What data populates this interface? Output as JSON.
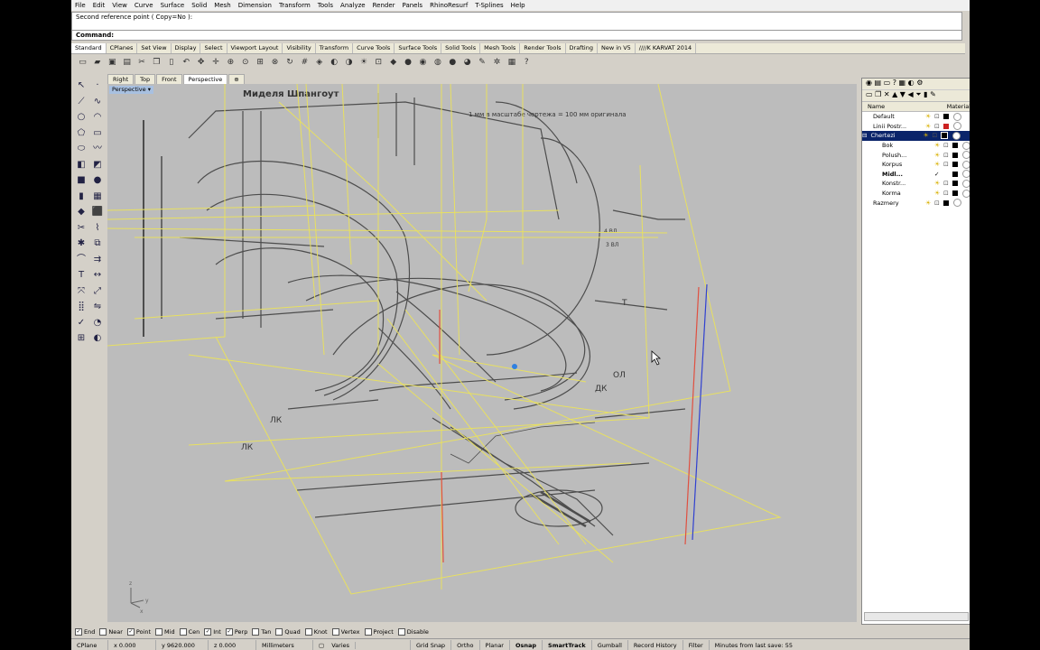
{
  "menu": [
    "File",
    "Edit",
    "View",
    "Curve",
    "Surface",
    "Solid",
    "Mesh",
    "Dimension",
    "Transform",
    "Tools",
    "Analyze",
    "Render",
    "Panels",
    "RhinoResurf",
    "T-Splines",
    "Help"
  ],
  "command": {
    "history": "Second reference point ( Copy=No ):",
    "prompt": "Command:"
  },
  "toolbar_tabs": [
    "Standard",
    "CPlanes",
    "Set View",
    "Display",
    "Select",
    "Viewport Layout",
    "Visibility",
    "Transform",
    "Curve Tools",
    "Surface Tools",
    "Solid Tools",
    "Mesh Tools",
    "Render Tools",
    "Drafting",
    "New in V5",
    "////K KARVAT 2014"
  ],
  "viewport_tabs": [
    "Right",
    "Top",
    "Front",
    "Perspective",
    "⊕"
  ],
  "viewport": {
    "title": "Perspective",
    "drawing_texts": [
      "Миделя Шпангоут",
      "1 мм в масштабе чертежа = 100 мм оригинала",
      "ЛК",
      "ОЛ",
      "ДК",
      "Т",
      "ЛК",
      "4 ВЛ",
      "3 ВЛ"
    ]
  },
  "layers": {
    "columns": [
      "Name",
      "Material"
    ],
    "rows": [
      {
        "name": "Default",
        "color": "#000000",
        "indent": false,
        "selected": false
      },
      {
        "name": "Linii Postr...",
        "color": "#cc2222",
        "indent": false,
        "selected": false
      },
      {
        "name": "Chertezi",
        "color": "#000000",
        "indent": false,
        "selected": true,
        "expander": "⊟"
      },
      {
        "name": "Bok",
        "color": "#000000",
        "indent": true,
        "selected": false
      },
      {
        "name": "Polush...",
        "color": "#000000",
        "indent": true,
        "selected": false
      },
      {
        "name": "Korpus",
        "color": "#000000",
        "indent": true,
        "selected": false
      },
      {
        "name": "Midl...",
        "color": "#000000",
        "indent": true,
        "selected": false,
        "current": "✓",
        "bold": true
      },
      {
        "name": "Konstr...",
        "color": "#000000",
        "indent": true,
        "selected": false
      },
      {
        "name": "Korma",
        "color": "#000000",
        "indent": true,
        "selected": false
      },
      {
        "name": "Razmery",
        "color": "#000000",
        "indent": false,
        "selected": false
      }
    ]
  },
  "osnap": [
    {
      "label": "End",
      "checked": true
    },
    {
      "label": "Near",
      "checked": false
    },
    {
      "label": "Point",
      "checked": true
    },
    {
      "label": "Mid",
      "checked": false
    },
    {
      "label": "Cen",
      "checked": false
    },
    {
      "label": "Int",
      "checked": true
    },
    {
      "label": "Perp",
      "checked": true
    },
    {
      "label": "Tan",
      "checked": false
    },
    {
      "label": "Quad",
      "checked": false
    },
    {
      "label": "Knot",
      "checked": false
    },
    {
      "label": "Vertex",
      "checked": false
    },
    {
      "label": "Project",
      "checked": false
    },
    {
      "label": "Disable",
      "checked": false
    }
  ],
  "status": {
    "cplane": "CPlane",
    "x": "x 0.000",
    "y": "y 9620.000",
    "z": "z 0.000",
    "units": "Millimeters",
    "layer": "Varies",
    "grid_snap": "Grid Snap",
    "ortho": "Ortho",
    "planar": "Planar",
    "osnap": "Osnap",
    "smarttrack": "SmartTrack",
    "gumball": "Gumball",
    "record_history": "Record History",
    "filter": "Filter",
    "save_info": "Minutes from last save: 55"
  },
  "colors": {
    "wireframe": "#e8e060",
    "axis_red": "#e05040",
    "axis_blue": "#3040d0",
    "selection": "#0a246a"
  }
}
